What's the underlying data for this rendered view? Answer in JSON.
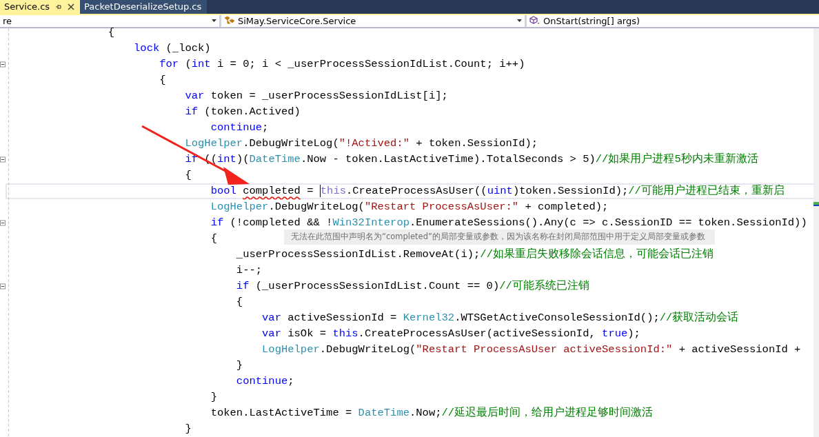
{
  "tabs": [
    {
      "label": "Service.cs",
      "selected": true,
      "pinned": true
    },
    {
      "label": "PacketDeserializeSetup.cs",
      "selected": false,
      "pinned": false
    }
  ],
  "nav": {
    "project": "re",
    "type": "SiMay.ServiceCore.Service",
    "member": "OnStart(string[] args)"
  },
  "code_lines": [
    {
      "collapsible": false,
      "current": false,
      "tokens": [
        {
          "kind": "plain",
          "text": "                {"
        }
      ]
    },
    {
      "collapsible": false,
      "current": false,
      "tokens": [
        {
          "kind": "kw",
          "text": "                    lock"
        },
        {
          "kind": "plain",
          "text": " (_lock)"
        }
      ]
    },
    {
      "collapsible": true,
      "current": false,
      "tokens": [
        {
          "kind": "kw",
          "text": "                        for"
        },
        {
          "kind": "plain",
          "text": " ("
        },
        {
          "kind": "kw",
          "text": "int"
        },
        {
          "kind": "plain",
          "text": " i = 0; i < _userProcessSessionIdList.Count; i++)"
        }
      ]
    },
    {
      "collapsible": false,
      "current": false,
      "tokens": [
        {
          "kind": "plain",
          "text": "                        {"
        }
      ]
    },
    {
      "collapsible": false,
      "current": false,
      "tokens": [
        {
          "kind": "kw",
          "text": "                            var"
        },
        {
          "kind": "plain",
          "text": " token = _userProcessSessionIdList[i];"
        }
      ]
    },
    {
      "collapsible": false,
      "current": false,
      "tokens": [
        {
          "kind": "kw",
          "text": "                            if"
        },
        {
          "kind": "plain",
          "text": " (token.Actived)"
        }
      ]
    },
    {
      "collapsible": false,
      "current": false,
      "tokens": [
        {
          "kind": "kw",
          "text": "                                continue"
        },
        {
          "kind": "plain",
          "text": ";"
        }
      ]
    },
    {
      "collapsible": false,
      "current": false,
      "tokens": [
        {
          "kind": "type",
          "text": "                            LogHelper"
        },
        {
          "kind": "plain",
          "text": ".DebugWriteLog("
        },
        {
          "kind": "str",
          "text": "\"!Actived:\""
        },
        {
          "kind": "plain",
          "text": " + token.SessionId);"
        }
      ]
    },
    {
      "collapsible": true,
      "current": false,
      "tokens": [
        {
          "kind": "kw",
          "text": "                            if"
        },
        {
          "kind": "plain",
          "text": " (("
        },
        {
          "kind": "kw",
          "text": "int"
        },
        {
          "kind": "plain",
          "text": ")("
        },
        {
          "kind": "type",
          "text": "DateTime"
        },
        {
          "kind": "plain",
          "text": ".Now - token.LastActiveTime).TotalSeconds > 5)"
        },
        {
          "kind": "cmt",
          "text": "//如果用户进程5秒内未重新激活"
        }
      ]
    },
    {
      "collapsible": false,
      "current": false,
      "tokens": [
        {
          "kind": "plain",
          "text": "                            {"
        }
      ]
    },
    {
      "collapsible": false,
      "current": true,
      "tokens": [
        {
          "kind": "kw",
          "text": "                                bool "
        },
        {
          "kind": "err",
          "text": "completed"
        },
        {
          "kind": "plain",
          "text": " = "
        },
        {
          "kind": "kw",
          "text": "this",
          "caret": true
        },
        {
          "kind": "plain",
          "text": ".CreateProcessAsUser(("
        },
        {
          "kind": "kw",
          "text": "uint"
        },
        {
          "kind": "plain",
          "text": ")token.SessionId);"
        },
        {
          "kind": "cmt",
          "text": "//可能用户进程已结束，重新启"
        }
      ]
    },
    {
      "collapsible": false,
      "current": false,
      "tokens": [
        {
          "kind": "type",
          "text": "                                LogHelper"
        },
        {
          "kind": "plain",
          "text": ".DebugWriteLog("
        },
        {
          "kind": "str",
          "text": "\"Restart ProcessAsUser:\""
        },
        {
          "kind": "plain",
          "text": " + completed);"
        }
      ]
    },
    {
      "collapsible": true,
      "current": false,
      "tokens": [
        {
          "kind": "kw",
          "text": "                                if"
        },
        {
          "kind": "plain",
          "text": " (!completed && !"
        },
        {
          "kind": "type",
          "text": "Win32Interop"
        },
        {
          "kind": "plain",
          "text": ".EnumerateSessions().Any(c => c.SessionID == token.SessionId))"
        }
      ]
    },
    {
      "collapsible": false,
      "current": false,
      "tokens": [
        {
          "kind": "plain",
          "text": "                                {"
        }
      ]
    },
    {
      "collapsible": false,
      "current": false,
      "tokens": [
        {
          "kind": "plain",
          "text": "                                    _userProcessSessionIdList.RemoveAt(i);"
        },
        {
          "kind": "cmt",
          "text": "//如果重启失败移除会话信息，可能会话已注销"
        }
      ]
    },
    {
      "collapsible": false,
      "current": false,
      "tokens": [
        {
          "kind": "plain",
          "text": "                                    i--;"
        }
      ]
    },
    {
      "collapsible": true,
      "current": false,
      "tokens": [
        {
          "kind": "kw",
          "text": "                                    if"
        },
        {
          "kind": "plain",
          "text": " (_userProcessSessionIdList.Count == 0)"
        },
        {
          "kind": "cmt",
          "text": "//可能系统已注销"
        }
      ]
    },
    {
      "collapsible": false,
      "current": false,
      "tokens": [
        {
          "kind": "plain",
          "text": "                                    {"
        }
      ]
    },
    {
      "collapsible": false,
      "current": false,
      "tokens": [
        {
          "kind": "kw",
          "text": "                                        var"
        },
        {
          "kind": "plain",
          "text": " activeSessionId = "
        },
        {
          "kind": "type",
          "text": "Kernel32"
        },
        {
          "kind": "plain",
          "text": ".WTSGetActiveConsoleSessionId();"
        },
        {
          "kind": "cmt",
          "text": "//获取活动会话"
        }
      ]
    },
    {
      "collapsible": false,
      "current": false,
      "tokens": [
        {
          "kind": "kw",
          "text": "                                        var"
        },
        {
          "kind": "plain",
          "text": " isOk = "
        },
        {
          "kind": "kw",
          "text": "this"
        },
        {
          "kind": "plain",
          "text": ".CreateProcessAsUser(activeSessionId, "
        },
        {
          "kind": "kw",
          "text": "true"
        },
        {
          "kind": "plain",
          "text": ");"
        }
      ]
    },
    {
      "collapsible": false,
      "current": false,
      "tokens": [
        {
          "kind": "type",
          "text": "                                        LogHelper"
        },
        {
          "kind": "plain",
          "text": ".DebugWriteLog("
        },
        {
          "kind": "str",
          "text": "\"Restart ProcessAsUser activeSessionId:\""
        },
        {
          "kind": "plain",
          "text": " + activeSessionId +"
        }
      ]
    },
    {
      "collapsible": false,
      "current": false,
      "tokens": [
        {
          "kind": "plain",
          "text": "                                    }"
        }
      ]
    },
    {
      "collapsible": false,
      "current": false,
      "tokens": [
        {
          "kind": "kw",
          "text": "                                    continue"
        },
        {
          "kind": "plain",
          "text": ";"
        }
      ]
    },
    {
      "collapsible": false,
      "current": false,
      "tokens": [
        {
          "kind": "plain",
          "text": "                                }"
        }
      ]
    },
    {
      "collapsible": false,
      "current": false,
      "tokens": [
        {
          "kind": "plain",
          "text": "                                token.LastActiveTime = "
        },
        {
          "kind": "type",
          "text": "DateTime"
        },
        {
          "kind": "plain",
          "text": ".Now;"
        },
        {
          "kind": "cmt",
          "text": "//延迟最后时间，给用户进程足够时间激活"
        }
      ]
    },
    {
      "collapsible": false,
      "current": false,
      "tokens": [
        {
          "kind": "plain",
          "text": "                            }"
        }
      ]
    }
  ],
  "tooltip": {
    "message": "无法在此范围中声明名为“completed”的局部变量或参数，因为该名称在封闭局部范围中用于定义局部变量或参数"
  }
}
